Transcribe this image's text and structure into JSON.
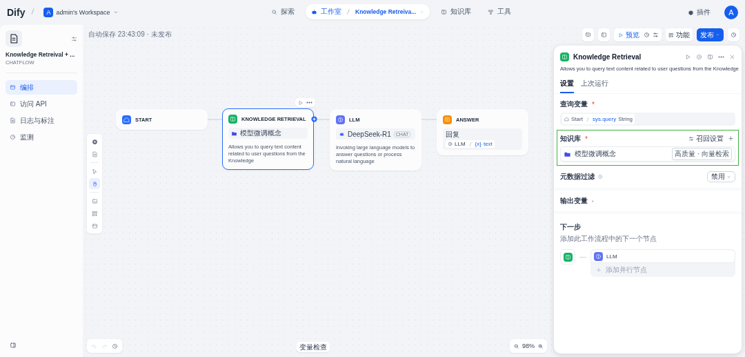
{
  "brand": {
    "logo": "Dify",
    "workspace_initial": "A",
    "workspace": "admin's Workspace"
  },
  "nav": [
    {
      "label": "探索",
      "selected": false
    },
    {
      "label": "工作室",
      "selected": true,
      "crumb": "Knowledge Retreiva..."
    },
    {
      "label": "知识库",
      "selected": false
    },
    {
      "label": "工具",
      "selected": false
    }
  ],
  "plugins": "插件",
  "avatar": "A",
  "app": {
    "name": "Knowledge Retreival + ...",
    "type": "CHATFLOW"
  },
  "sidebar_items": [
    {
      "label": "编排",
      "selected": true
    },
    {
      "label": "访问 API",
      "selected": false
    },
    {
      "label": "日志与标注",
      "selected": false
    },
    {
      "label": "监测",
      "selected": false
    }
  ],
  "autosave": "自动保存 23:43:09 · 未发布",
  "toolbar": {
    "preview": "预览",
    "features": "功能",
    "publish": "发布"
  },
  "tools": [
    {
      "kind": "add",
      "selected": false
    },
    {
      "kind": "note",
      "selected": false
    },
    {
      "kind": "pointer",
      "selected": false
    },
    {
      "kind": "hand",
      "selected": true
    },
    {
      "kind": "export",
      "selected": false
    },
    {
      "kind": "organize",
      "selected": false
    },
    {
      "kind": "minimap",
      "selected": false
    }
  ],
  "nodes": [
    {
      "kind": "start",
      "title": "START",
      "selected": false
    },
    {
      "kind": "knowledge",
      "title": "KNOWLEDGE RETRIEVAL",
      "selected": true,
      "chip": "模型微调概念",
      "description": "Allows you to query text content related to user questions from the Knowledge"
    },
    {
      "kind": "llm",
      "title": "LLM",
      "selected": false,
      "model": "DeepSeek-R1",
      "badge": "CHAT",
      "description": "Invoking large language models to answer questions or process natural language"
    },
    {
      "kind": "answer",
      "title": "ANSWER",
      "selected": false,
      "label": "回复",
      "source": "LLM",
      "var_icon": "{x}",
      "variable": "text"
    }
  ],
  "panel": {
    "title": "Knowledge Retrieval",
    "description": "Allows you to query text content related to user questions from the Knowledge",
    "tabs": [
      {
        "label": "设置",
        "selected": true
      },
      {
        "label": "上次运行",
        "selected": false
      }
    ],
    "required_mark": "*",
    "query_label": "查询变量",
    "query_source": "Start",
    "query_var": "sys.query",
    "query_type": "String",
    "kb_label": "知识库",
    "recall": "召回设置",
    "kb_item": "模型微调概念",
    "kb_tag": "高质量 · 向量检索",
    "filter_label": "元数据过滤",
    "filter_value": "禁用",
    "output_label": "输出变量",
    "next_title": "下一步",
    "next_hint": "添加此工作流程中的下一个节点",
    "next_node": "LLM",
    "add_parallel": "添加并行节点"
  },
  "variable_inspect": "变量检查",
  "zoom": "98%"
}
